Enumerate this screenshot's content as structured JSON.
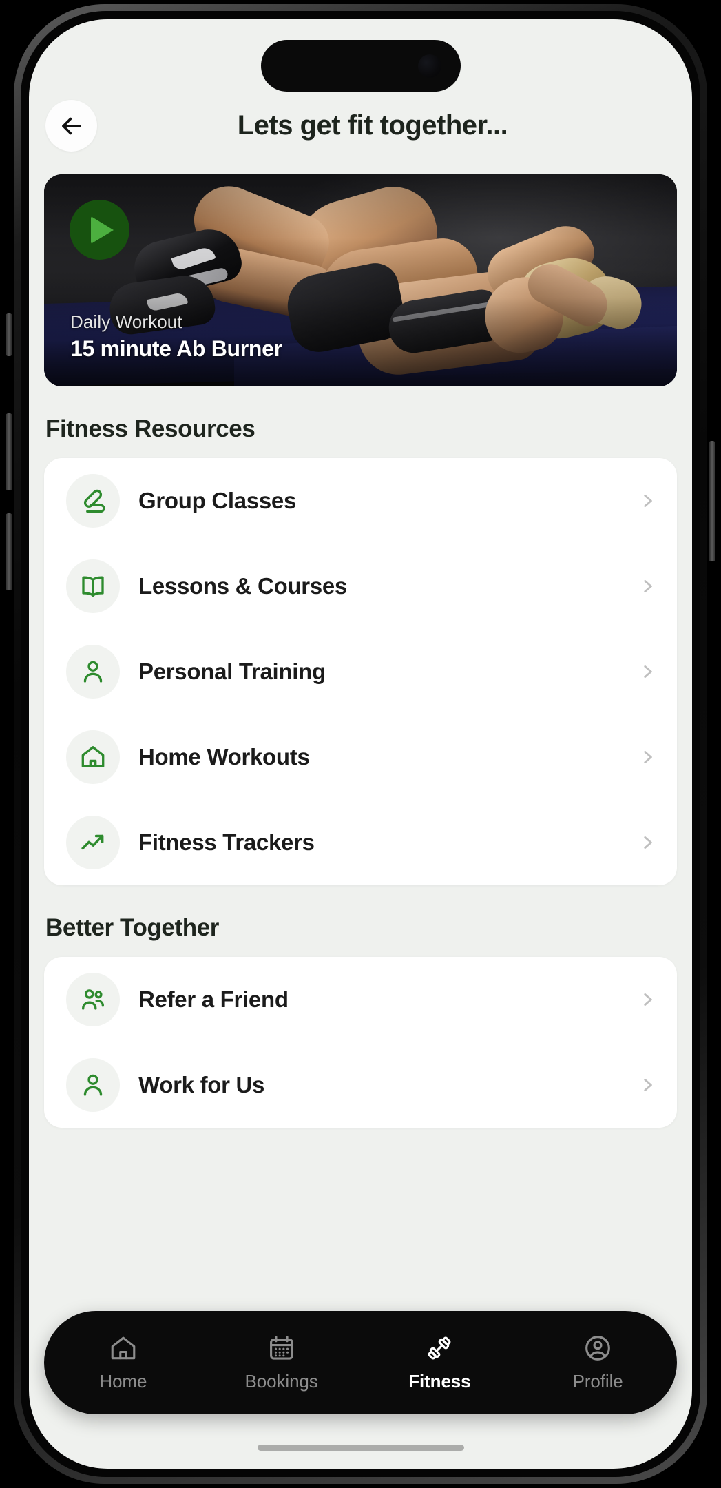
{
  "header": {
    "back_icon": "arrow-left-icon",
    "title": "Lets get fit together..."
  },
  "hero": {
    "play_icon": "play-icon",
    "eyebrow": "Daily Workout",
    "headline": "15 minute Ab Burner"
  },
  "sections": [
    {
      "title": "Fitness Resources",
      "items": [
        {
          "label": "Group Classes",
          "icon": "group-classes-icon",
          "chevron": "chevron-right-icon"
        },
        {
          "label": "Lessons & Courses",
          "icon": "book-open-icon",
          "chevron": "chevron-right-icon"
        },
        {
          "label": "Personal Training",
          "icon": "person-icon",
          "chevron": "chevron-right-icon"
        },
        {
          "label": "Home Workouts",
          "icon": "home-icon",
          "chevron": "chevron-right-icon"
        },
        {
          "label": "Fitness Trackers",
          "icon": "trending-up-icon",
          "chevron": "chevron-right-icon"
        }
      ]
    },
    {
      "title": "Better Together",
      "items": [
        {
          "label": "Refer a Friend",
          "icon": "people-group-icon",
          "chevron": "chevron-right-icon"
        },
        {
          "label": "Work for Us",
          "icon": "person-icon",
          "chevron": "chevron-right-icon"
        }
      ]
    }
  ],
  "bottom_nav": [
    {
      "label": "Home",
      "icon": "home-icon",
      "active": false
    },
    {
      "label": "Bookings",
      "icon": "calendar-icon",
      "active": false
    },
    {
      "label": "Fitness",
      "icon": "dumbbell-icon",
      "active": true
    },
    {
      "label": "Profile",
      "icon": "account-icon",
      "active": false
    }
  ],
  "colors": {
    "screen_background": "#eff1ee",
    "card_background": "#ffffff",
    "accent_green": "#2e8b2e",
    "play_circle": "#17520f",
    "play_triangle": "#4caf3f",
    "nav_background": "#0b0b0b",
    "nav_active": "#ffffff",
    "nav_inactive": "#8d8d8d",
    "text_primary": "#1b1b1b"
  }
}
